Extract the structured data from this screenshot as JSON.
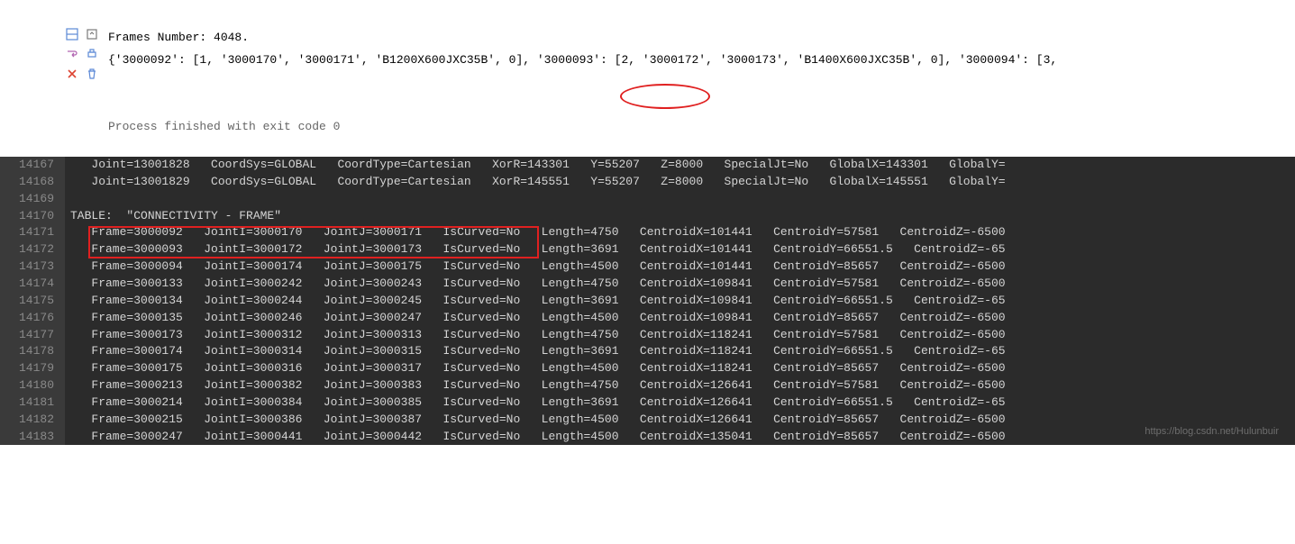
{
  "console": {
    "frames_line": "Frames Number: 4048.",
    "dict_line": "{'3000092': [1, '3000170', '3000171', 'B1200X600JXC35B', 0], '3000093': [2, '3000172', '3000173', 'B1400X600JXC35B', 0], '3000094': [3,",
    "exit_line": "Process finished with exit code 0"
  },
  "editor": {
    "lines": [
      {
        "no": "14167",
        "code": "   Joint=13001828   CoordSys=GLOBAL   CoordType=Cartesian   XorR=143301   Y=55207   Z=8000   SpecialJt=No   GlobalX=143301   GlobalY="
      },
      {
        "no": "14168",
        "code": "   Joint=13001829   CoordSys=GLOBAL   CoordType=Cartesian   XorR=145551   Y=55207   Z=8000   SpecialJt=No   GlobalX=145551   GlobalY="
      },
      {
        "no": "14169",
        "code": ""
      },
      {
        "no": "14170",
        "code": "TABLE:  \"CONNECTIVITY - FRAME\""
      },
      {
        "no": "14171",
        "code": "   Frame=3000092   JointI=3000170   JointJ=3000171   IsCurved=No   Length=4750   CentroidX=101441   CentroidY=57581   CentroidZ=-6500"
      },
      {
        "no": "14172",
        "code": "   Frame=3000093   JointI=3000172   JointJ=3000173   IsCurved=No   Length=3691   CentroidX=101441   CentroidY=66551.5   CentroidZ=-65"
      },
      {
        "no": "14173",
        "code": "   Frame=3000094   JointI=3000174   JointJ=3000175   IsCurved=No   Length=4500   CentroidX=101441   CentroidY=85657   CentroidZ=-6500"
      },
      {
        "no": "14174",
        "code": "   Frame=3000133   JointI=3000242   JointJ=3000243   IsCurved=No   Length=4750   CentroidX=109841   CentroidY=57581   CentroidZ=-6500"
      },
      {
        "no": "14175",
        "code": "   Frame=3000134   JointI=3000244   JointJ=3000245   IsCurved=No   Length=3691   CentroidX=109841   CentroidY=66551.5   CentroidZ=-65"
      },
      {
        "no": "14176",
        "code": "   Frame=3000135   JointI=3000246   JointJ=3000247   IsCurved=No   Length=4500   CentroidX=109841   CentroidY=85657   CentroidZ=-6500"
      },
      {
        "no": "14177",
        "code": "   Frame=3000173   JointI=3000312   JointJ=3000313   IsCurved=No   Length=4750   CentroidX=118241   CentroidY=57581   CentroidZ=-6500"
      },
      {
        "no": "14178",
        "code": "   Frame=3000174   JointI=3000314   JointJ=3000315   IsCurved=No   Length=3691   CentroidX=118241   CentroidY=66551.5   CentroidZ=-65"
      },
      {
        "no": "14179",
        "code": "   Frame=3000175   JointI=3000316   JointJ=3000317   IsCurved=No   Length=4500   CentroidX=118241   CentroidY=85657   CentroidZ=-6500"
      },
      {
        "no": "14180",
        "code": "   Frame=3000213   JointI=3000382   JointJ=3000383   IsCurved=No   Length=4750   CentroidX=126641   CentroidY=57581   CentroidZ=-6500"
      },
      {
        "no": "14181",
        "code": "   Frame=3000214   JointI=3000384   JointJ=3000385   IsCurved=No   Length=3691   CentroidX=126641   CentroidY=66551.5   CentroidZ=-65"
      },
      {
        "no": "14182",
        "code": "   Frame=3000215   JointI=3000386   JointJ=3000387   IsCurved=No   Length=4500   CentroidX=126641   CentroidY=85657   CentroidZ=-6500"
      },
      {
        "no": "14183",
        "code": "   Frame=3000247   JointI=3000441   JointJ=3000442   IsCurved=No   Length=4500   CentroidX=135041   CentroidY=85657   CentroidZ=-6500"
      }
    ]
  },
  "watermark": "https://blog.csdn.net/Hulunbuir"
}
